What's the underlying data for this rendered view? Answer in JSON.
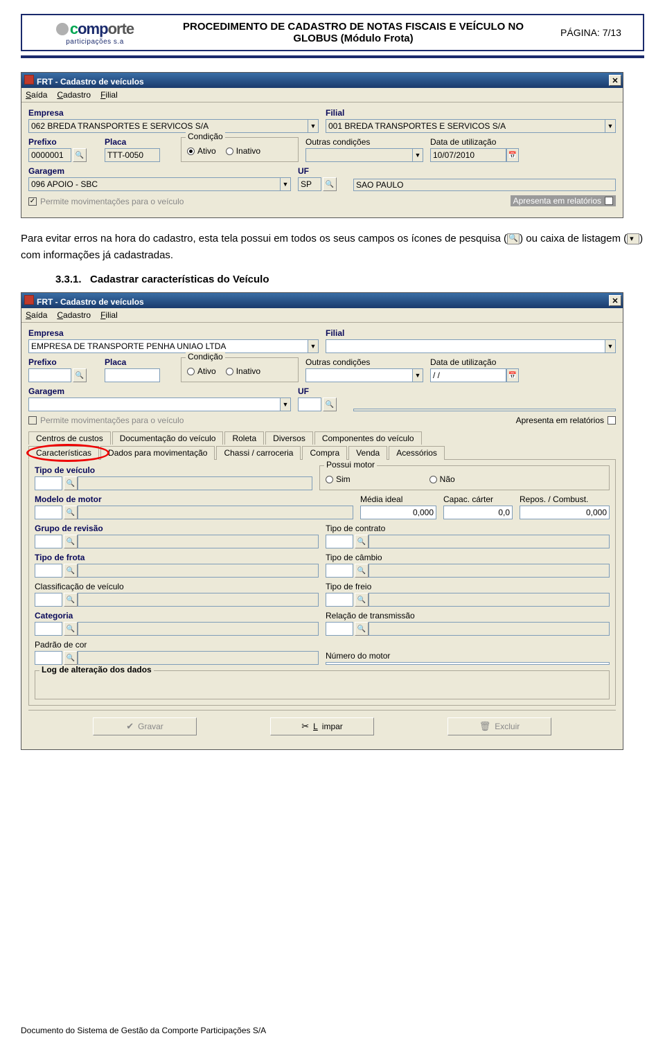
{
  "header": {
    "logo_brand_1": "c",
    "logo_brand_2": "omp",
    "logo_brand_3": "orte",
    "logo_sub": "participações s.a",
    "title": "PROCEDIMENTO DE CADASTRO DE NOTAS FISCAIS E VEÍCULO NO GLOBUS (Módulo Frota)",
    "page_label": "PÁGINA: 7/13"
  },
  "body": {
    "para_1a": "Para evitar erros na hora do cadastro, esta tela possui em todos os seus campos os ícones de pesquisa (",
    "para_1b": ") ou caixa de listagem (",
    "para_1c": ") com informações já cadastradas.",
    "sec_num": "3.3.1.",
    "sec_title": "Cadastrar características do Veículo"
  },
  "win1": {
    "title": "FRT - Cadastro de veículos",
    "menu": {
      "m1": "Saída",
      "m2": "Cadastro",
      "m3": "Filial"
    },
    "empresa_label": "Empresa",
    "empresa_val": "062 BREDA TRANSPORTES E SERVICOS S/A",
    "filial_label": "Filial",
    "filial_val": "001 BREDA TRANSPORTES E SERVICOS S/A",
    "prefixo_label": "Prefixo",
    "prefixo_val": "0000001",
    "placa_label": "Placa",
    "placa_val": "TTT-0050",
    "cond_label": "Condição",
    "cond_ativo": "Ativo",
    "cond_inativo": "Inativo",
    "outras_label": "Outras condições",
    "outras_val": "",
    "data_label": "Data de utilização",
    "data_val": "10/07/2010",
    "garagem_label": "Garagem",
    "garagem_val": "096 APOIO - SBC",
    "uf_label": "UF",
    "uf_val": "SP",
    "uf_desc": "SAO PAULO",
    "permite": "Permite movimentações para o veículo",
    "apresenta": "Apresenta em relatórios"
  },
  "win2": {
    "title": "FRT - Cadastro de veículos",
    "menu": {
      "m1": "Saída",
      "m2": "Cadastro",
      "m3": "Filial"
    },
    "empresa_label": "Empresa",
    "empresa_val": "EMPRESA DE TRANSPORTE PENHA UNIAO LTDA",
    "filial_label": "Filial",
    "filial_val": "",
    "prefixo_label": "Prefixo",
    "prefixo_val": "",
    "placa_label": "Placa",
    "placa_val": "",
    "cond_label": "Condição",
    "cond_ativo": "Ativo",
    "cond_inativo": "Inativo",
    "outras_label": "Outras condições",
    "outras_val": "",
    "data_label": "Data de utilização",
    "data_val": "/  /",
    "garagem_label": "Garagem",
    "garagem_val": "",
    "uf_label": "UF",
    "uf_val": "",
    "uf_desc": "",
    "permite": "Permite movimentações para o veículo",
    "apresenta": "Apresenta em relatórios",
    "tabs_top": {
      "t1": "Centros de custos",
      "t2": "Documentação do veículo",
      "t3": "Roleta",
      "t4": "Diversos",
      "t5": "Componentes do veículo"
    },
    "tabs_bot": {
      "t1": "Características",
      "t2": "Dados para movimentação",
      "t3": "Chassi / carroceria",
      "t4": "Compra",
      "t5": "Venda",
      "t6": "Acessórios"
    },
    "panel": {
      "tipo_veic": "Tipo de veículo",
      "possui_motor": "Possui motor",
      "sim": "Sim",
      "nao": "Não",
      "modelo": "Modelo de motor",
      "media": "Média ideal",
      "media_v": "0,000",
      "capac": "Capac. cárter",
      "capac_v": "0,0",
      "repos": "Repos. / Combust.",
      "repos_v": "0,000",
      "grupo": "Grupo de revisão",
      "tipo_contrato": "Tipo de contrato",
      "tipo_frota": "Tipo de frota",
      "tipo_cambio": "Tipo de câmbio",
      "classif": "Classificação de veículo",
      "tipo_freio": "Tipo de freio",
      "categoria": "Categoria",
      "relacao": "Relação de transmissão",
      "padrao": "Padrão de cor",
      "numero_motor": "Número do motor",
      "log": "Log de alteração dos dados"
    },
    "btns": {
      "gravar": "Gravar",
      "limpar": "Limpar",
      "excluir": "Excluir"
    }
  },
  "footer": "Documento do Sistema de Gestão da Comporte Participações S/A"
}
